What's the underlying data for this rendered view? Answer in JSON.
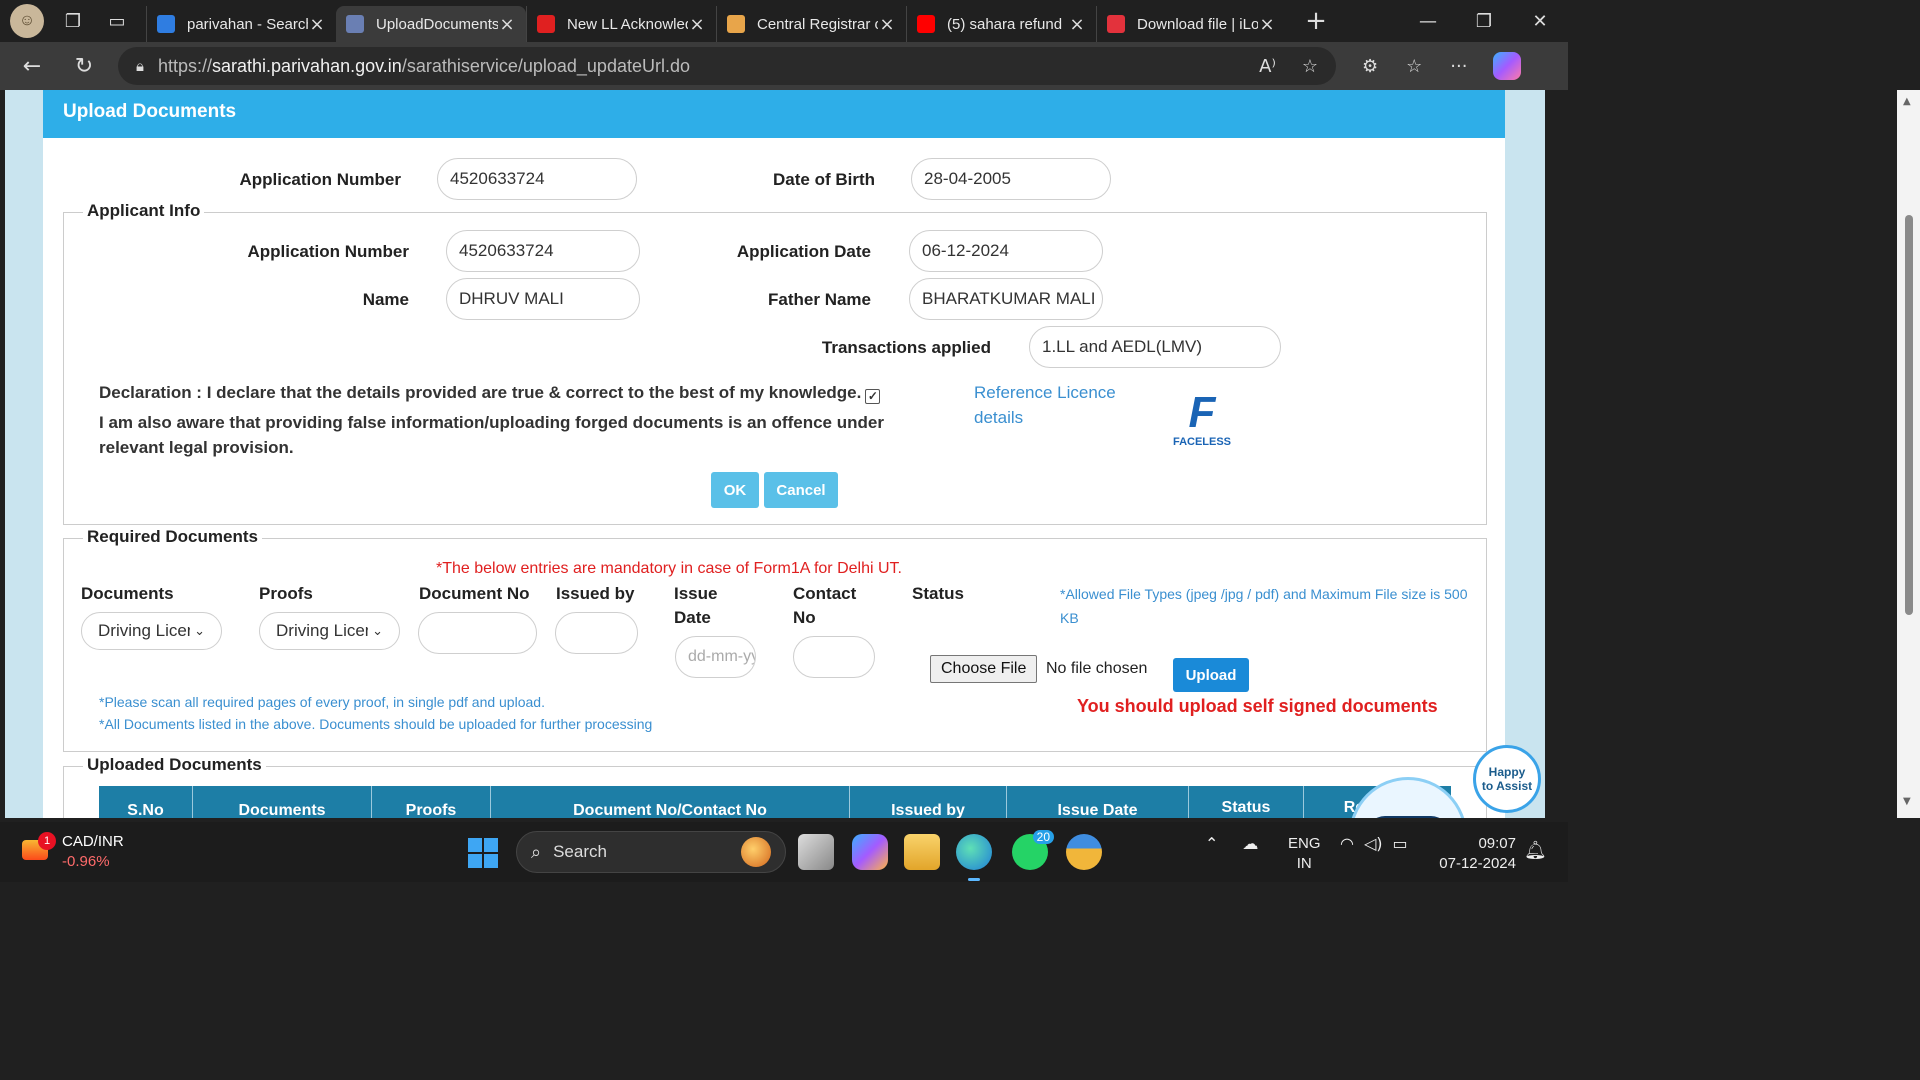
{
  "browser": {
    "tabs": [
      {
        "title": "parivahan - Search",
        "favicon": "search-icon",
        "color": "#2f7de1"
      },
      {
        "title": "UploadDocuments",
        "favicon": "emblem-icon",
        "color": "#6a7fb3"
      },
      {
        "title": "New LL Acknowledgement",
        "favicon": "pdf-icon",
        "color": "#e02020"
      },
      {
        "title": "Central Registrar of",
        "favicon": "emblem-icon",
        "color": "#e8a54a"
      },
      {
        "title": "(5) sahara refund",
        "favicon": "youtube-icon",
        "color": "#ff0000"
      },
      {
        "title": "Download file | iLovePDF",
        "favicon": "heart-icon",
        "color": "#e3323c"
      }
    ],
    "active_tab": 1,
    "url_scheme": "https://",
    "url_host": "sarathi.parivahan.gov.in",
    "url_path": "/sarathiservice/upload_updateUrl.do"
  },
  "page": {
    "header": "Upload Documents",
    "top": {
      "app_no_label": "Application Number",
      "app_no": "4520633724",
      "dob_label": "Date of Birth",
      "dob": "28-04-2005"
    },
    "applicant": {
      "legend": "Applicant Info",
      "app_no_label": "Application Number",
      "app_no": "4520633724",
      "app_date_label": "Application Date",
      "app_date": "06-12-2024",
      "name_label": "Name",
      "name": "DHRUV MALI",
      "father_label": "Father Name",
      "father": "BHARATKUMAR MALI",
      "trans_label": "Transactions applied",
      "trans": "1.LL and AEDL(LMV)",
      "declaration": "Declaration : I declare that the details provided are true & correct to the best of my knowledge.",
      "declaration_2": "I am also aware that providing false information/uploading forged documents is an offence under relevant legal provision.",
      "ref_link": "Reference Licence details",
      "faceless": "FACELESS",
      "ok": "OK",
      "cancel": "Cancel"
    },
    "required": {
      "legend": "Required Documents",
      "mandatory_note": "*The below entries are mandatory in case of Form1A for Delhi UT.",
      "col_documents": "Documents",
      "col_proofs": "Proofs",
      "col_docno": "Document No",
      "col_issued": "Issued by",
      "col_issue_date": "Issue Date",
      "col_contact": "Contact No",
      "col_status": "Status",
      "allowed": "*Allowed File Types (jpeg /jpg / pdf) and Maximum File size is 500 KB",
      "documents_value": "Driving Licence",
      "proofs_value": "Driving Licence",
      "date_placeholder": "dd-mm-yyyy",
      "choose_file": "Choose File",
      "no_file": "No file chosen",
      "upload": "Upload",
      "warning": "You should upload self signed documents",
      "note1": "*Please scan all required pages of every proof, in single pdf and upload.",
      "note2": "*All Documents listed in the above. Documents should be uploaded for further processing"
    },
    "uploaded": {
      "legend": "Uploaded Documents",
      "columns": [
        "S.No",
        "Documents",
        "Proofs",
        "Document No/Contact No",
        "Issued by",
        "Issue Date",
        "Status",
        "Remarks"
      ]
    },
    "assistant": {
      "line1": "Happy",
      "line2": "to Assist"
    }
  },
  "taskbar": {
    "ticker_symbol": "CAD/INR",
    "ticker_change": "-0.96%",
    "ticker_badge": "1",
    "search": "Search",
    "whatsapp_badge": "20",
    "lang1": "ENG",
    "lang2": "IN",
    "time": "09:07",
    "date": "07-12-2024"
  }
}
